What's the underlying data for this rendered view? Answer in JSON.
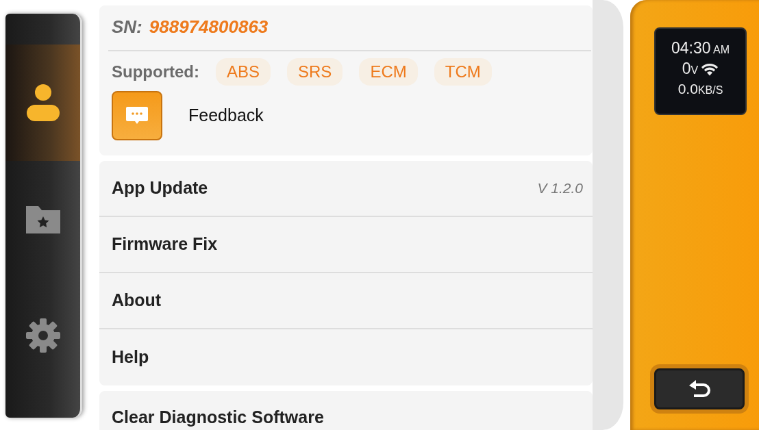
{
  "sidebar": {
    "items": [
      {
        "kind": "profile",
        "selected": true
      },
      {
        "kind": "favorites",
        "selected": false
      },
      {
        "kind": "settings",
        "selected": false
      }
    ]
  },
  "device": {
    "sn_label": "SN:",
    "sn": "988974800863",
    "supported_label": "Supported:",
    "supported": [
      "ABS",
      "SRS",
      "ECM",
      "TCM"
    ],
    "feedback": "Feedback"
  },
  "menu": [
    {
      "label": "App Update",
      "value": "V 1.2.0"
    },
    {
      "label": "Firmware Fix"
    },
    {
      "label": "About"
    },
    {
      "label": "Help"
    }
  ],
  "extra_item": "Clear Diagnostic Software",
  "status": {
    "time": "04:30",
    "meridiem": "AM",
    "voltage": "0",
    "voltage_unit": "V",
    "speed": "0.0",
    "speed_unit": "KB/S"
  }
}
